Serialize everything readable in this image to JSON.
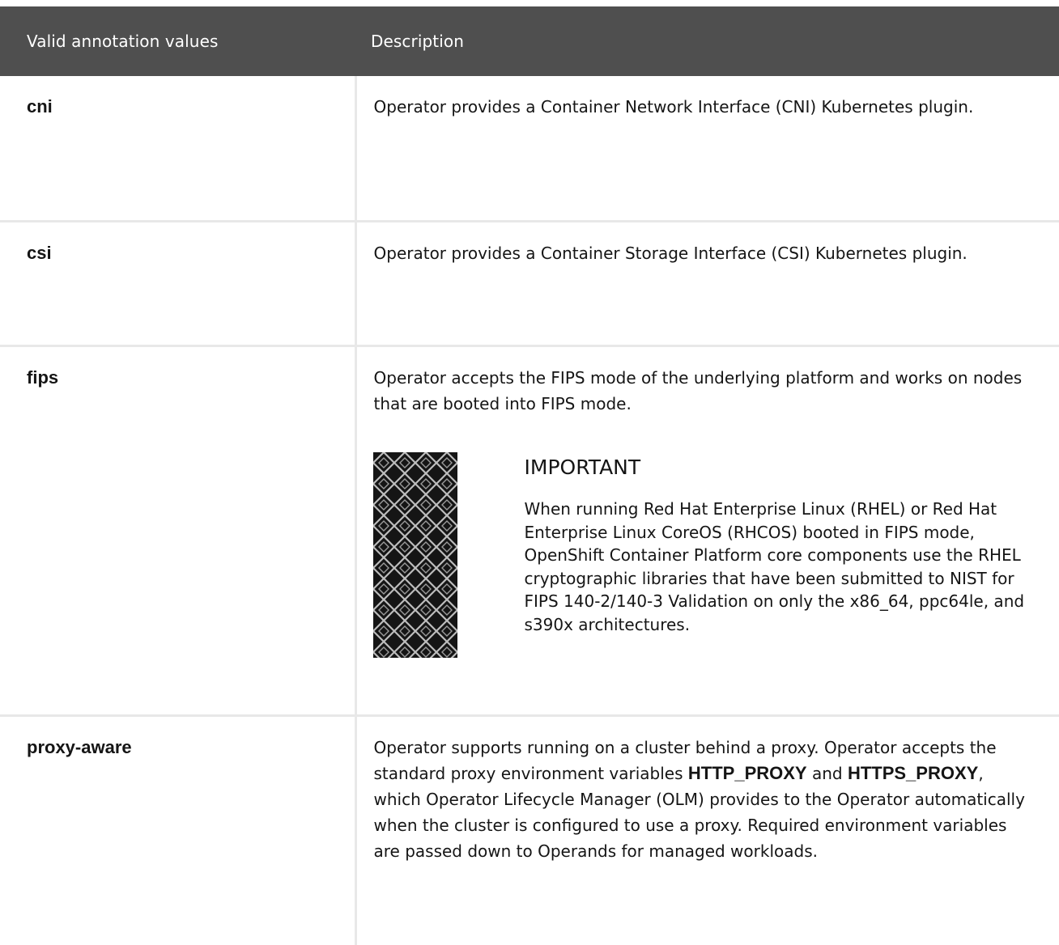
{
  "table": {
    "headers": {
      "values": "Valid annotation values",
      "description": "Description"
    },
    "rows": [
      {
        "value": "cni",
        "description": "Operator provides a Container Network Interface (CNI) Kubernetes plugin."
      },
      {
        "value": "csi",
        "description": "Operator provides a Container Storage Interface (CSI) Kubernetes plugin."
      },
      {
        "value": "fips",
        "description": "Operator accepts the FIPS mode of the underlying platform and works on nodes that are booted into FIPS mode.",
        "admonition": {
          "icon": "important-pattern-icon",
          "title": "IMPORTANT",
          "text": "When running Red Hat Enterprise Linux (RHEL) or Red Hat Enterprise Linux CoreOS (RHCOS) booted in FIPS mode, OpenShift Container Platform core components use the RHEL cryptographic libraries that have been submitted to NIST for FIPS 140-2/140-3 Validation on only the x86_64, ppc64le, and s390x architectures."
        }
      },
      {
        "value": "proxy-aware",
        "description": {
          "part1": "Operator supports running on a cluster behind a proxy. Operator accepts the standard proxy environment variables ",
          "code1": "HTTP_PROXY",
          "part2": " and ",
          "code2": "HTTPS_PROXY",
          "part3": ", which Operator Lifecycle Manager (OLM) provides to the Operator automatically when the cluster is configured to use a proxy. Required environment variables are passed down to Operands for managed workloads."
        }
      }
    ]
  }
}
